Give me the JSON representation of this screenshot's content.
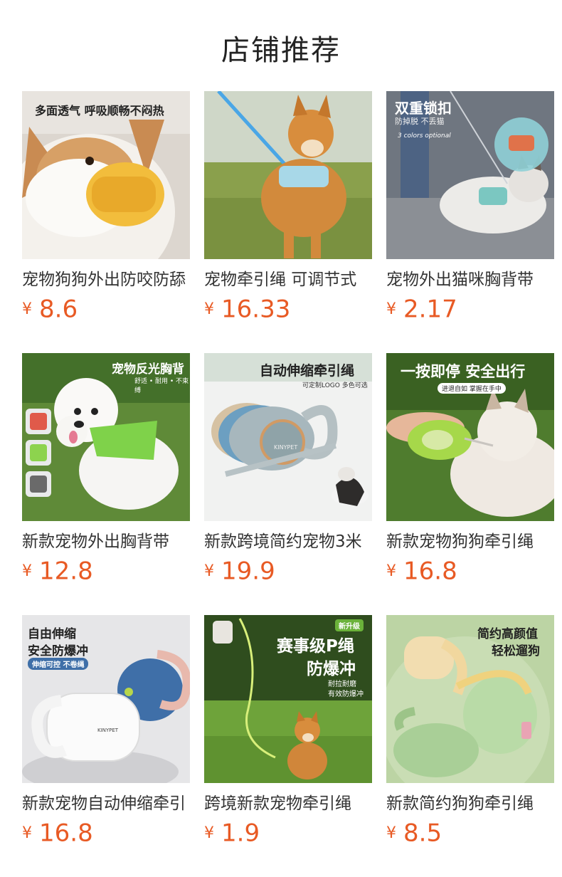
{
  "page_title": "店铺推荐",
  "currency_symbol": "¥",
  "products": [
    {
      "name": "宠物狗狗外出防咬防舔",
      "price": "8.6",
      "img_text": [
        "多面透气 呼吸顺畅不闷热"
      ]
    },
    {
      "name": "宠物牵引绳 可调节式",
      "price": "16.33",
      "img_text": []
    },
    {
      "name": "宠物外出猫咪胸背带",
      "price": "2.17",
      "img_text": [
        "双重锁扣",
        "防掉脱 不丢猫",
        "3 colors optional"
      ]
    },
    {
      "name": "新款宠物外出胸背带",
      "price": "12.8",
      "img_text": [
        "宠物反光胸背",
        "舒适 • 耐用 • 不束缚"
      ]
    },
    {
      "name": "新款跨境简约宠物3米",
      "price": "19.9",
      "img_text": [
        "自动伸缩牵引绳",
        "可定制LOGO 多色可选",
        "KINYPET"
      ]
    },
    {
      "name": "新款宠物狗狗牵引绳",
      "price": "16.8",
      "img_text": [
        "一按即停 安全出行",
        "进退自如 掌握在手中"
      ]
    },
    {
      "name": "新款宠物自动伸缩牵引",
      "price": "16.8",
      "img_text": [
        "自由伸缩",
        "安全防爆冲",
        "伸缩可控 不卷绳",
        "KINYPET"
      ]
    },
    {
      "name": "跨境新款宠物牵引绳",
      "price": "1.9",
      "img_text": [
        "新升级",
        "赛事级P绳",
        "防爆冲",
        "耐拉耐磨",
        "有效防爆冲"
      ]
    },
    {
      "name": "新款简约狗狗牵引绳",
      "price": "8.5",
      "img_text": [
        "简约高颜值",
        "轻松遛狗"
      ]
    }
  ]
}
